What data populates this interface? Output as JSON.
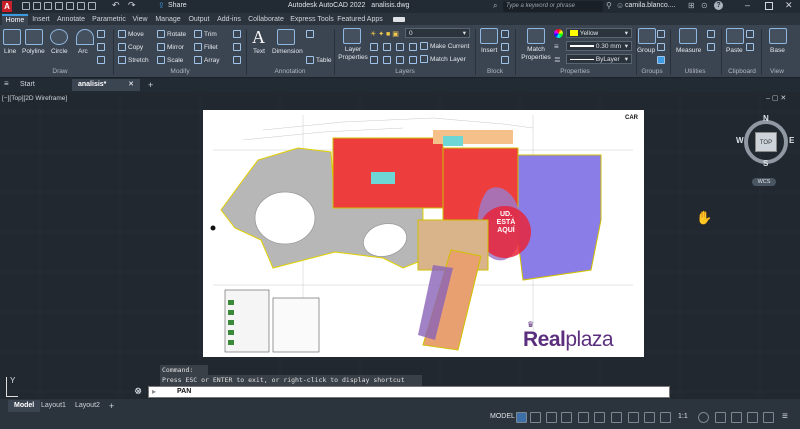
{
  "app": {
    "title": "Autodesk AutoCAD 2022",
    "filename": "analisis.dwg",
    "share_label": "Share",
    "search_placeholder": "Type a keyword or phrase",
    "user": "camila.blanco....",
    "help_label": "?"
  },
  "ribbon_tabs": [
    "Home",
    "Insert",
    "Annotate",
    "Parametric",
    "View",
    "Manage",
    "Output",
    "Add-ins",
    "Collaborate",
    "Express Tools",
    "Featured Apps"
  ],
  "ribbon": {
    "draw": {
      "title": "Draw",
      "line": "Line",
      "polyline": "Polyline",
      "circle": "Circle",
      "arc": "Arc"
    },
    "modify": {
      "title": "Modify",
      "move": "Move",
      "rotate": "Rotate",
      "trim": "Trim",
      "copy": "Copy",
      "mirror": "Mirror",
      "fillet": "Fillet",
      "stretch": "Stretch",
      "scale": "Scale",
      "array": "Array"
    },
    "annotation": {
      "title": "Annotation",
      "text": "Text",
      "dimension": "Dimension",
      "table": "Table"
    },
    "layers": {
      "title": "Layers",
      "layer_properties": "Layer Properties",
      "current_layer": "0",
      "make_current": "Make Current",
      "match_layer": "Match Layer"
    },
    "block": {
      "title": "Block",
      "insert": "Insert"
    },
    "properties": {
      "title": "Properties",
      "match_properties": "Match Properties",
      "color": "Yellow",
      "lineweight": "0.30 mm",
      "linetype": "ByLayer"
    },
    "groups": {
      "title": "Groups",
      "group": "Group"
    },
    "utilities": {
      "title": "Utilities",
      "measure": "Measure"
    },
    "clipboard": {
      "title": "Clipboard",
      "paste": "Paste"
    },
    "view": {
      "title": "View",
      "base": "Base"
    }
  },
  "doc_tabs": {
    "start": "Start",
    "active": "analisis*",
    "add": "+"
  },
  "viewport": {
    "controls": "[−][Top][2D Wireframe]"
  },
  "drawing": {
    "corner_label": "CAR",
    "here_text_line1": "UD.",
    "here_text_line2": "ESTÁ",
    "here_text_line3": "AQUÍ",
    "brand_prefix": "Real",
    "brand_suffix": "plaza"
  },
  "viewcube": {
    "top": "TOP",
    "n": "N",
    "s": "S",
    "e": "E",
    "w": "W",
    "wcs": "WCS"
  },
  "command": {
    "history_label": "Command:",
    "prompt": "Press ESC or ENTER to exit, or right-click to display shortcut menu.",
    "input_value": "PAN"
  },
  "axis": {
    "y": "Y"
  },
  "layout_tabs": [
    "Model",
    "Layout1",
    "Layout2"
  ],
  "layout_add": "+",
  "status": {
    "model": "MODEL",
    "scale": "1:1"
  },
  "colors": {
    "accent": "#3c9ae0",
    "red_zone": "#ee3d3d",
    "blue_zone": "#8a7de8",
    "orange_zone": "#e8a070",
    "grey_zone": "#b7b7b7",
    "brand": "#5b2f7e"
  }
}
